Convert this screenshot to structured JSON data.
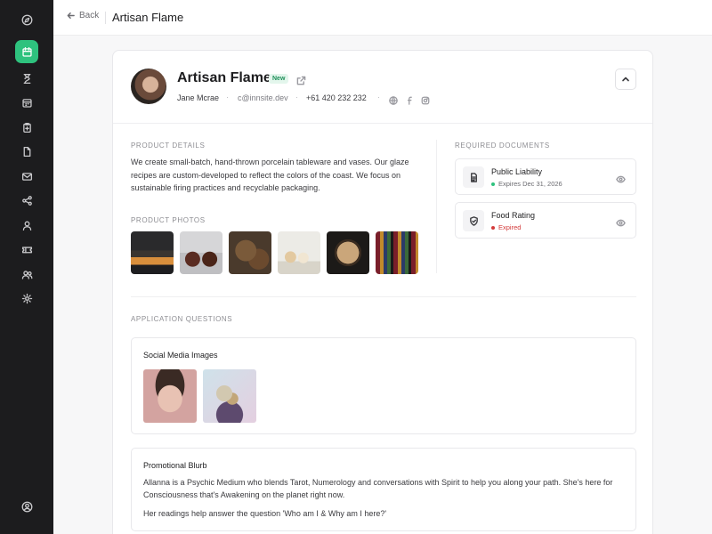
{
  "nav": {
    "back_label": "Back",
    "page_title": "Artisan Flame"
  },
  "sidebar": {
    "icons": [
      "compass-icon",
      "calendar-icon",
      "hourglass-icon",
      "calendar-grid-icon",
      "clipboard-icon",
      "file-icon",
      "mail-icon",
      "share-icon",
      "user-icon",
      "ticket-icon",
      "users-icon",
      "gear-icon",
      "account-icon"
    ],
    "active": "calendar-icon"
  },
  "profile": {
    "name": "Artisan Flame",
    "badge": "New",
    "contact_name": "Jane Mcrae",
    "email": "c@innsite.dev",
    "phone": "+61 420 232 232"
  },
  "product_details": {
    "label": "PRODUCT DETAILS",
    "description": "We create small-batch, hand-thrown porcelain tableware and vases. Our glaze recipes are custom-developed to reflect the colors of the coast. We focus on sustainable firing practices and recyclable packaging."
  },
  "product_photos": {
    "label": "PRODUCT PHOTOS"
  },
  "required_documents": {
    "label": "REQUIRED DOCUMENTS",
    "items": [
      {
        "title": "Public Liability",
        "status": "Expires Dec 31, 2026",
        "status_color": "#2ec27e"
      },
      {
        "title": "Food Rating",
        "status": "Expired",
        "status_color": "#d33a3a"
      }
    ]
  },
  "application_questions": {
    "label": "APPLICATION QUESTIONS",
    "social_media": {
      "title": "Social Media Images"
    },
    "promotional_blurb": {
      "title": "Promotional Blurb",
      "paragraph1": "Allanna is a Psychic Medium who blends Tarot, Numerology and conversations with Spirit to help you along your path. She's here for Consciousness that's Awakening on the planet right now.",
      "paragraph2": "Her readings help answer the question 'Who am I & Why am I here?'"
    }
  },
  "colors": {
    "accent": "#2ec27e",
    "sidebar": "#1c1c1e",
    "danger": "#d33a3a"
  }
}
